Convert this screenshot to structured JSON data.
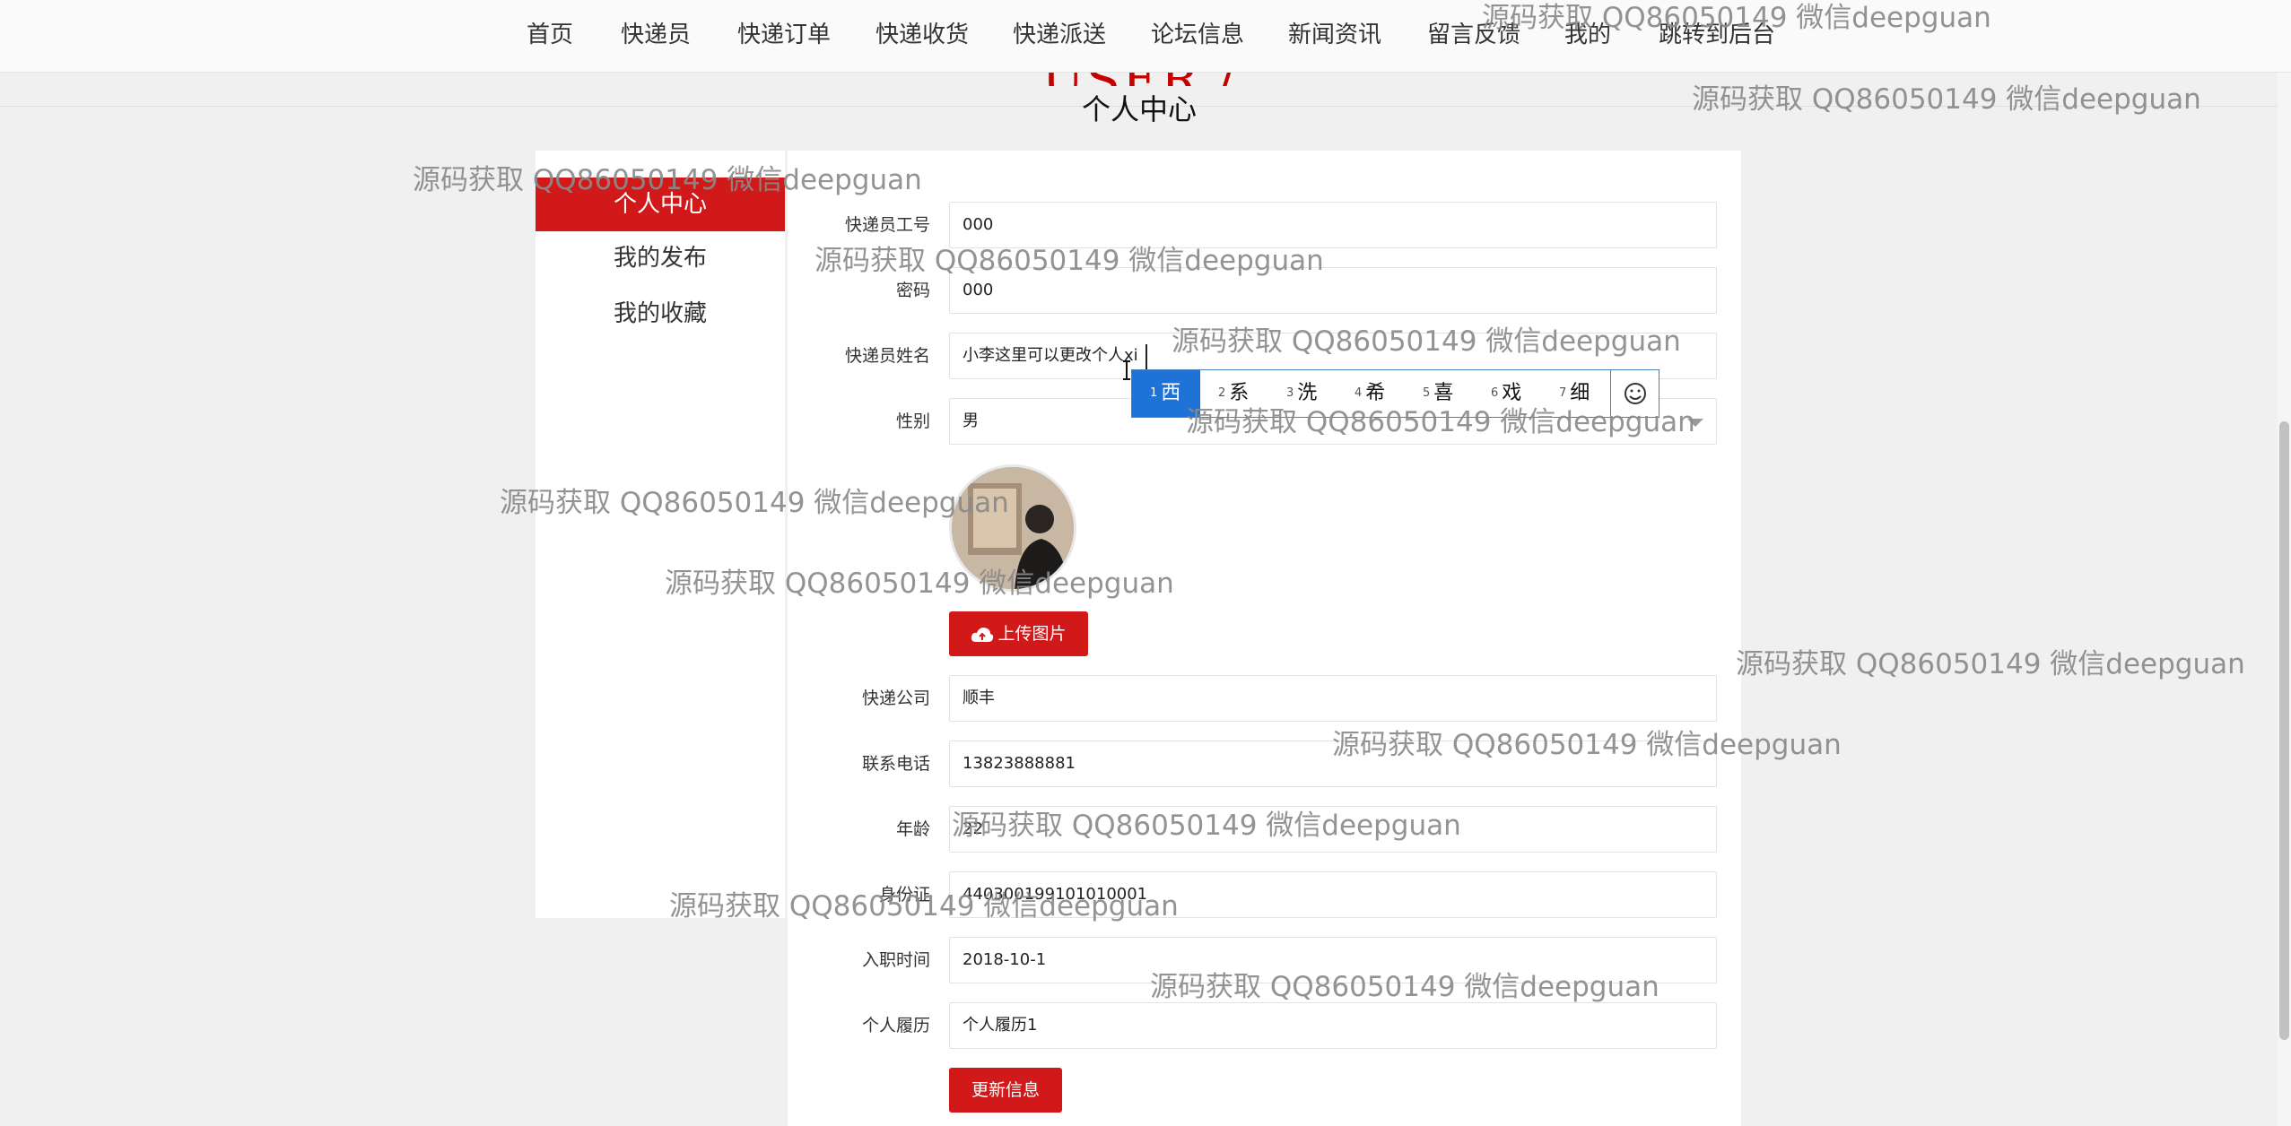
{
  "nav": {
    "items": [
      "首页",
      "快递员",
      "快递订单",
      "快递收货",
      "快递派送",
      "论坛信息",
      "新闻资讯",
      "留言反馈",
      "我的",
      "跳转到后台"
    ]
  },
  "banner": {
    "en_title": "USER / CENTER",
    "title": "个人中心"
  },
  "sidebar": {
    "items": [
      {
        "label": "个人中心",
        "active": true
      },
      {
        "label": "我的发布",
        "active": false
      },
      {
        "label": "我的收藏",
        "active": false
      }
    ]
  },
  "form": {
    "courier_no": {
      "label": "快递员工号",
      "value": "000"
    },
    "password": {
      "label": "密码",
      "value": "000"
    },
    "name": {
      "label": "快递员姓名",
      "value": "小李这里可以更改个人xi"
    },
    "gender": {
      "label": "性别",
      "value": "男"
    },
    "upload_label": "上传图片",
    "company": {
      "label": "快递公司",
      "value": "顺丰"
    },
    "phone": {
      "label": "联系电话",
      "value": "13823888881"
    },
    "age": {
      "label": "年龄",
      "value": "22"
    },
    "id_card": {
      "label": "身份证",
      "value": "440300199101010001"
    },
    "hire_date": {
      "label": "入职时间",
      "value": "2018-10-1"
    },
    "resume": {
      "label": "个人履历",
      "value": "个人履历1"
    },
    "update_label": "更新信息"
  },
  "ime": {
    "candidates": [
      {
        "num": "1",
        "text": "西"
      },
      {
        "num": "2",
        "text": "系"
      },
      {
        "num": "3",
        "text": "洗"
      },
      {
        "num": "4",
        "text": "希"
      },
      {
        "num": "5",
        "text": "喜"
      },
      {
        "num": "6",
        "text": "戏"
      },
      {
        "num": "7",
        "text": "细"
      }
    ],
    "selected_index": 0,
    "emoji_icon": "smiley-icon"
  },
  "watermark": "源码获取 QQ86050149 微信deepguan",
  "colors": {
    "accent": "#d11919",
    "ime_select": "#1f73d6",
    "page_bg": "#f0f0f0"
  }
}
